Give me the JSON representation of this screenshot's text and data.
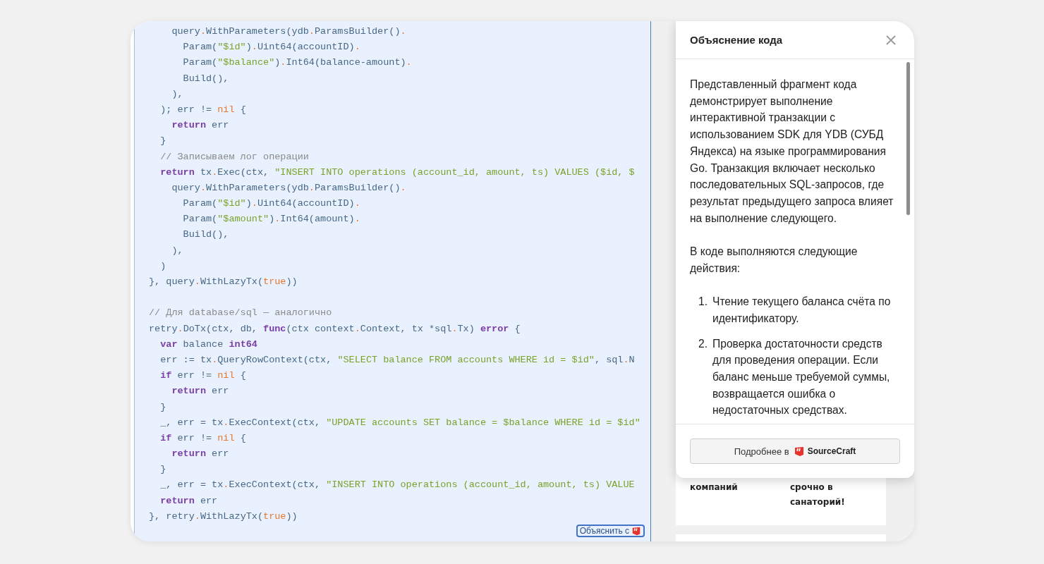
{
  "code_blocks": [
    {
      "lines": [
        [
          {
            "kind": "plain",
            "text": "    query"
          },
          {
            "kind": "dot",
            "text": "."
          },
          {
            "kind": "plain",
            "text": "WithParameters(ydb"
          },
          {
            "kind": "dot",
            "text": "."
          },
          {
            "kind": "plain",
            "text": "ParamsBuilder()"
          },
          {
            "kind": "dot",
            "text": "."
          }
        ],
        [
          {
            "kind": "plain",
            "text": "      Param("
          },
          {
            "kind": "string",
            "text": "\"$id\""
          },
          {
            "kind": "plain",
            "text": ")"
          },
          {
            "kind": "dot",
            "text": "."
          },
          {
            "kind": "plain",
            "text": "Uint64(accountID)"
          },
          {
            "kind": "dot",
            "text": "."
          }
        ],
        [
          {
            "kind": "plain",
            "text": "      Param("
          },
          {
            "kind": "string",
            "text": "\"$balance\""
          },
          {
            "kind": "plain",
            "text": ")"
          },
          {
            "kind": "dot",
            "text": "."
          },
          {
            "kind": "plain",
            "text": "Int64(balance-amount)"
          },
          {
            "kind": "dot",
            "text": "."
          }
        ],
        [
          {
            "kind": "plain",
            "text": "      Build(),"
          }
        ],
        [
          {
            "kind": "plain",
            "text": "    ),"
          }
        ],
        [
          {
            "kind": "plain",
            "text": "  ); err != "
          },
          {
            "kind": "literal",
            "text": "nil"
          },
          {
            "kind": "plain",
            "text": " {"
          }
        ],
        [
          {
            "kind": "keyword",
            "text": "    return"
          },
          {
            "kind": "plain",
            "text": " err"
          }
        ],
        [
          {
            "kind": "plain",
            "text": "  }"
          }
        ],
        [
          {
            "kind": "comment",
            "text": "  // Записываем лог операции"
          }
        ],
        [
          {
            "kind": "keyword",
            "text": "  return"
          },
          {
            "kind": "plain",
            "text": " tx"
          },
          {
            "kind": "dot",
            "text": "."
          },
          {
            "kind": "plain",
            "text": "Exec(ctx, "
          },
          {
            "kind": "string",
            "text": "\"INSERT INTO operations (account_id, amount, ts) VALUES ($id, $"
          }
        ],
        [
          {
            "kind": "plain",
            "text": "    query"
          },
          {
            "kind": "dot",
            "text": "."
          },
          {
            "kind": "plain",
            "text": "WithParameters(ydb"
          },
          {
            "kind": "dot",
            "text": "."
          },
          {
            "kind": "plain",
            "text": "ParamsBuilder()"
          },
          {
            "kind": "dot",
            "text": "."
          }
        ],
        [
          {
            "kind": "plain",
            "text": "      Param("
          },
          {
            "kind": "string",
            "text": "\"$id\""
          },
          {
            "kind": "plain",
            "text": ")"
          },
          {
            "kind": "dot",
            "text": "."
          },
          {
            "kind": "plain",
            "text": "Uint64(accountID)"
          },
          {
            "kind": "dot",
            "text": "."
          }
        ],
        [
          {
            "kind": "plain",
            "text": "      Param("
          },
          {
            "kind": "string",
            "text": "\"$amount\""
          },
          {
            "kind": "plain",
            "text": ")"
          },
          {
            "kind": "dot",
            "text": "."
          },
          {
            "kind": "plain",
            "text": "Int64(amount)"
          },
          {
            "kind": "dot",
            "text": "."
          }
        ],
        [
          {
            "kind": "plain",
            "text": "      Build(),"
          }
        ],
        [
          {
            "kind": "plain",
            "text": "    ),"
          }
        ],
        [
          {
            "kind": "plain",
            "text": "  )"
          }
        ],
        [
          {
            "kind": "plain",
            "text": "}, query"
          },
          {
            "kind": "dot",
            "text": "."
          },
          {
            "kind": "plain",
            "text": "WithLazyTx("
          },
          {
            "kind": "literal",
            "text": "true"
          },
          {
            "kind": "plain",
            "text": "))"
          }
        ]
      ]
    },
    {
      "lines": [
        [
          {
            "kind": "comment",
            "text": "// Для database/sql — аналогично"
          }
        ],
        [
          {
            "kind": "plain",
            "text": "retry"
          },
          {
            "kind": "dot",
            "text": "."
          },
          {
            "kind": "plain",
            "text": "DoTx(ctx, db, "
          },
          {
            "kind": "keyword",
            "text": "func"
          },
          {
            "kind": "plain",
            "text": "(ctx context"
          },
          {
            "kind": "dot",
            "text": "."
          },
          {
            "kind": "plain",
            "text": "Context, tx *sql"
          },
          {
            "kind": "dot",
            "text": "."
          },
          {
            "kind": "plain",
            "text": "Tx) "
          },
          {
            "kind": "keyword",
            "text": "error"
          },
          {
            "kind": "plain",
            "text": " {"
          }
        ],
        [
          {
            "kind": "keyword",
            "text": "  var"
          },
          {
            "kind": "plain",
            "text": " balance "
          },
          {
            "kind": "keyword",
            "text": "int64"
          }
        ],
        [
          {
            "kind": "plain",
            "text": "  err := tx"
          },
          {
            "kind": "dot",
            "text": "."
          },
          {
            "kind": "plain",
            "text": "QueryRowContext(ctx, "
          },
          {
            "kind": "string",
            "text": "\"SELECT balance FROM accounts WHERE id = $id\""
          },
          {
            "kind": "plain",
            "text": ", sql"
          },
          {
            "kind": "dot",
            "text": "."
          },
          {
            "kind": "plain",
            "text": "N"
          }
        ],
        [
          {
            "kind": "keyword",
            "text": "  if"
          },
          {
            "kind": "plain",
            "text": " err != "
          },
          {
            "kind": "literal",
            "text": "nil"
          },
          {
            "kind": "plain",
            "text": " {"
          }
        ],
        [
          {
            "kind": "keyword",
            "text": "    return"
          },
          {
            "kind": "plain",
            "text": " err"
          }
        ],
        [
          {
            "kind": "plain",
            "text": "  }"
          }
        ],
        [
          {
            "kind": "plain",
            "text": "  _, err = tx"
          },
          {
            "kind": "dot",
            "text": "."
          },
          {
            "kind": "plain",
            "text": "ExecContext(ctx, "
          },
          {
            "kind": "string",
            "text": "\"UPDATE accounts SET balance = $balance WHERE id = $id\""
          }
        ],
        [
          {
            "kind": "keyword",
            "text": "  if"
          },
          {
            "kind": "plain",
            "text": " err != "
          },
          {
            "kind": "literal",
            "text": "nil"
          },
          {
            "kind": "plain",
            "text": " {"
          }
        ],
        [
          {
            "kind": "keyword",
            "text": "    return"
          },
          {
            "kind": "plain",
            "text": " err"
          }
        ],
        [
          {
            "kind": "plain",
            "text": "  }"
          }
        ],
        [
          {
            "kind": "plain",
            "text": "  _, err = tx"
          },
          {
            "kind": "dot",
            "text": "."
          },
          {
            "kind": "plain",
            "text": "ExecContext(ctx, "
          },
          {
            "kind": "string",
            "text": "\"INSERT INTO operations (account_id, amount, ts) VALUE"
          }
        ],
        [
          {
            "kind": "keyword",
            "text": "  return"
          },
          {
            "kind": "plain",
            "text": " err"
          }
        ],
        [
          {
            "kind": "plain",
            "text": "}, retry"
          },
          {
            "kind": "dot",
            "text": "."
          },
          {
            "kind": "plain",
            "text": "WithLazyTx("
          },
          {
            "kind": "literal",
            "text": "true"
          },
          {
            "kind": "plain",
            "text": "))"
          }
        ]
      ]
    }
  ],
  "explain_button": {
    "label": "Объяснить с"
  },
  "background_card": {
    "columns": [
      "компаний",
      "срочно в санаторий!"
    ]
  },
  "popup": {
    "title": "Объяснение кода",
    "paragraphs": [
      "Представленный фрагмент кода демонстрирует выполнение интерактивной транзакции с использованием SDK для YDB (СУБД Яндекса) на языке программирования Go. Транзакция включает несколько последовательных SQL-запросов, где результат предыдущего запроса влияет на выполнение следующего.",
      "В коде выполняются следующие действия:"
    ],
    "list": [
      {
        "number": "1.",
        "text": "Чтение текущего баланса счёта по идентификатору."
      },
      {
        "number": "2.",
        "text": "Проверка достаточности средств для проведения операции. Если баланс меньше требуемой суммы, возвращается ошибка о недостаточных средствах."
      }
    ],
    "footer_button": {
      "prefix": "Подробнее в",
      "brand": "SourceCraft"
    }
  }
}
